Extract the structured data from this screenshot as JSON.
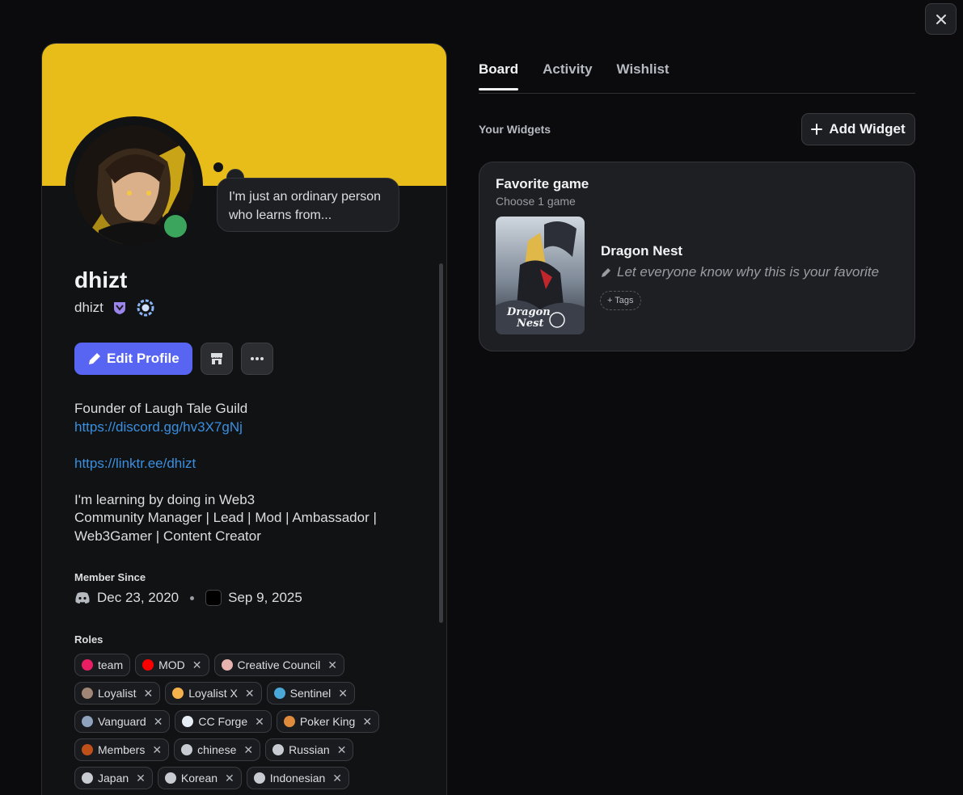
{
  "close": {
    "icon": "close-icon"
  },
  "profile": {
    "status_text": "I'm just an ordinary person who learns from...",
    "display_name": "dhizt",
    "username": "dhizt",
    "edit_label": "Edit Profile",
    "bio": {
      "line1": "Founder of Laugh Tale Guild",
      "link1": "https://discord.gg/hv3X7gNj",
      "link2": "https://linktr.ee/dhizt",
      "line2": "I'm learning by doing in Web3",
      "line3": "Community Manager | Lead | Mod | Ambassador |",
      "line4": "Web3Gamer | Content Creator"
    },
    "member_since_title": "Member Since",
    "discord_since": "Dec 23, 2020",
    "server_since": "Sep 9, 2025",
    "roles_title": "Roles",
    "roles": [
      {
        "name": "team",
        "color": "#e91e63",
        "removable": false
      },
      {
        "name": "MOD",
        "color": "#ff0000",
        "removable": true
      },
      {
        "name": "Creative Council",
        "color": "#e8b4b0",
        "removable": true
      },
      {
        "name": "Loyalist",
        "color": "#a08775",
        "removable": true
      },
      {
        "name": "Loyalist X",
        "color": "#f5b14c",
        "removable": true
      },
      {
        "name": "Sentinel",
        "color": "#4aa8d8",
        "removable": true
      },
      {
        "name": "Vanguard",
        "color": "#8fa3bf",
        "removable": true
      },
      {
        "name": "CC Forge",
        "color": "#e6edf5",
        "removable": true
      },
      {
        "name": "Poker King",
        "color": "#e08a3c",
        "removable": true
      },
      {
        "name": "Members",
        "color": "#c0501a",
        "removable": true
      },
      {
        "name": "chinese",
        "color": "#c8ccd2",
        "removable": true
      },
      {
        "name": "Russian",
        "color": "#c8ccd2",
        "removable": true
      },
      {
        "name": "Japan",
        "color": "#c8ccd2",
        "removable": true
      },
      {
        "name": "Korean",
        "color": "#c8ccd2",
        "removable": true
      },
      {
        "name": "Indonesian",
        "color": "#c8ccd2",
        "removable": true
      }
    ]
  },
  "tabs": {
    "board": "Board",
    "activity": "Activity",
    "wishlist": "Wishlist"
  },
  "widgets": {
    "label": "Your Widgets",
    "add_label": "Add Widget",
    "favorite": {
      "title": "Favorite game",
      "subtitle": "Choose 1 game",
      "game_name": "Dragon Nest",
      "prompt": "Let everyone know why this is your favorite",
      "tags_label": "+ Tags"
    }
  }
}
